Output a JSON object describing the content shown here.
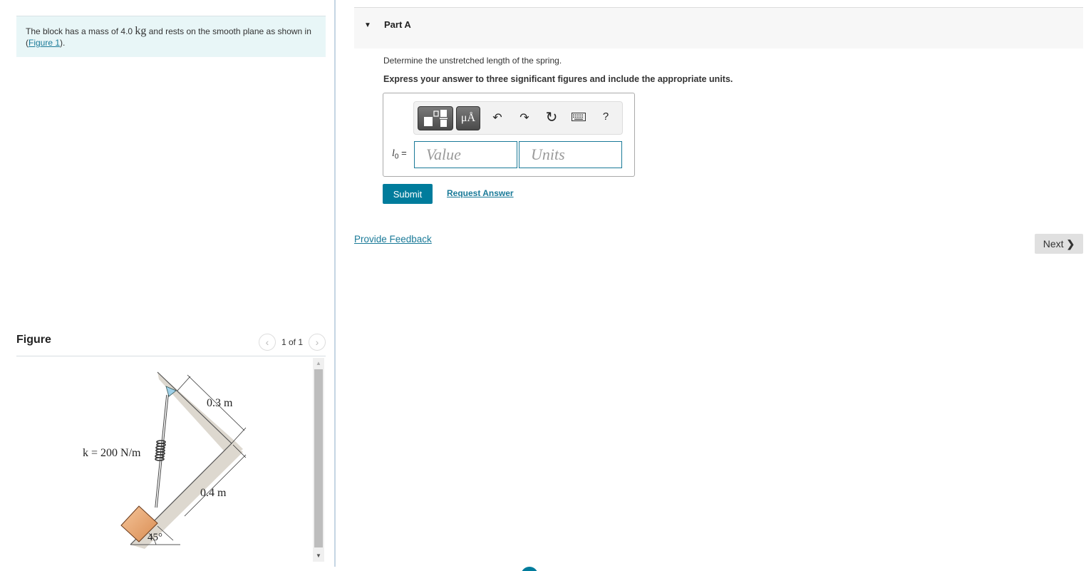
{
  "problem": {
    "text_before": "The block has a mass of 4.0 ",
    "unit": "kg",
    "text_after": " and rests on the smooth plane as shown in (",
    "figure_link": "Figure 1",
    "text_end": ")."
  },
  "figure": {
    "title": "Figure",
    "pager_text": "1 of 1",
    "prev_icon": "chevron-left-icon",
    "next_icon": "chevron-right-icon",
    "labels": {
      "spring_constant": "k = 200 N/m",
      "top_length": "0.3 m",
      "bottom_length": "0.4 m",
      "angle": "45°"
    }
  },
  "part": {
    "title": "Part A",
    "question": "Determine the unstretched length of the spring.",
    "instruction": "Express your answer to three significant figures and include the appropriate units.",
    "toolbar": {
      "units_label": "μÅ",
      "undo": "↶",
      "redo": "↷",
      "reset": "↻",
      "help": "?"
    },
    "answer_var": "l",
    "answer_sub": "0",
    "answer_eq": " =",
    "value_placeholder": "Value",
    "units_placeholder": "Units",
    "submit_label": "Submit",
    "request_answer_label": "Request Answer"
  },
  "footer": {
    "feedback_label": "Provide Feedback",
    "next_label": "Next",
    "next_chevron": "❯"
  },
  "colors": {
    "accent": "#007c9c",
    "link": "#1a7a98",
    "problem_bg": "#e8f6f7"
  }
}
